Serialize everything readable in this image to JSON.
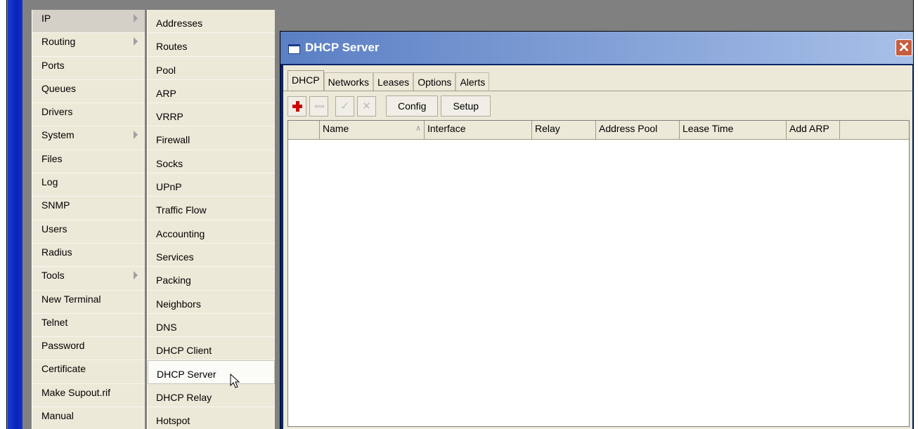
{
  "menu_primary": [
    {
      "label": "IP",
      "submenu": true,
      "highlight": true
    },
    {
      "label": "Routing",
      "submenu": true
    },
    {
      "label": "Ports"
    },
    {
      "label": "Queues"
    },
    {
      "label": "Drivers"
    },
    {
      "label": "System",
      "submenu": true
    },
    {
      "label": "Files"
    },
    {
      "label": "Log"
    },
    {
      "label": "SNMP"
    },
    {
      "label": "Users"
    },
    {
      "label": "Radius"
    },
    {
      "label": "Tools",
      "submenu": true
    },
    {
      "label": "New Terminal"
    },
    {
      "label": "Telnet"
    },
    {
      "label": "Password"
    },
    {
      "label": "Certificate"
    },
    {
      "label": "Make Supout.rif"
    },
    {
      "label": "Manual"
    }
  ],
  "menu_ip": [
    {
      "label": "Addresses"
    },
    {
      "label": "Routes"
    },
    {
      "label": "Pool"
    },
    {
      "label": "ARP"
    },
    {
      "label": "VRRP"
    },
    {
      "label": "Firewall"
    },
    {
      "label": "Socks"
    },
    {
      "label": "UPnP"
    },
    {
      "label": "Traffic Flow"
    },
    {
      "label": "Accounting"
    },
    {
      "label": "Services"
    },
    {
      "label": "Packing"
    },
    {
      "label": "Neighbors"
    },
    {
      "label": "DNS"
    },
    {
      "label": "DHCP Client"
    },
    {
      "label": "DHCP Server",
      "highlight": true
    },
    {
      "label": "DHCP Relay"
    },
    {
      "label": "Hotspot"
    }
  ],
  "window": {
    "title": "DHCP Server",
    "close_glyph": "✕",
    "tabs": [
      "DHCP",
      "Networks",
      "Leases",
      "Options",
      "Alerts"
    ],
    "toolbar": {
      "config_label": "Config",
      "setup_label": "Setup"
    },
    "columns": [
      "",
      "Name",
      "Interface",
      "Relay",
      "Address Pool",
      "Lease Time",
      "Add ARP"
    ],
    "sort_indicator": "∧"
  }
}
